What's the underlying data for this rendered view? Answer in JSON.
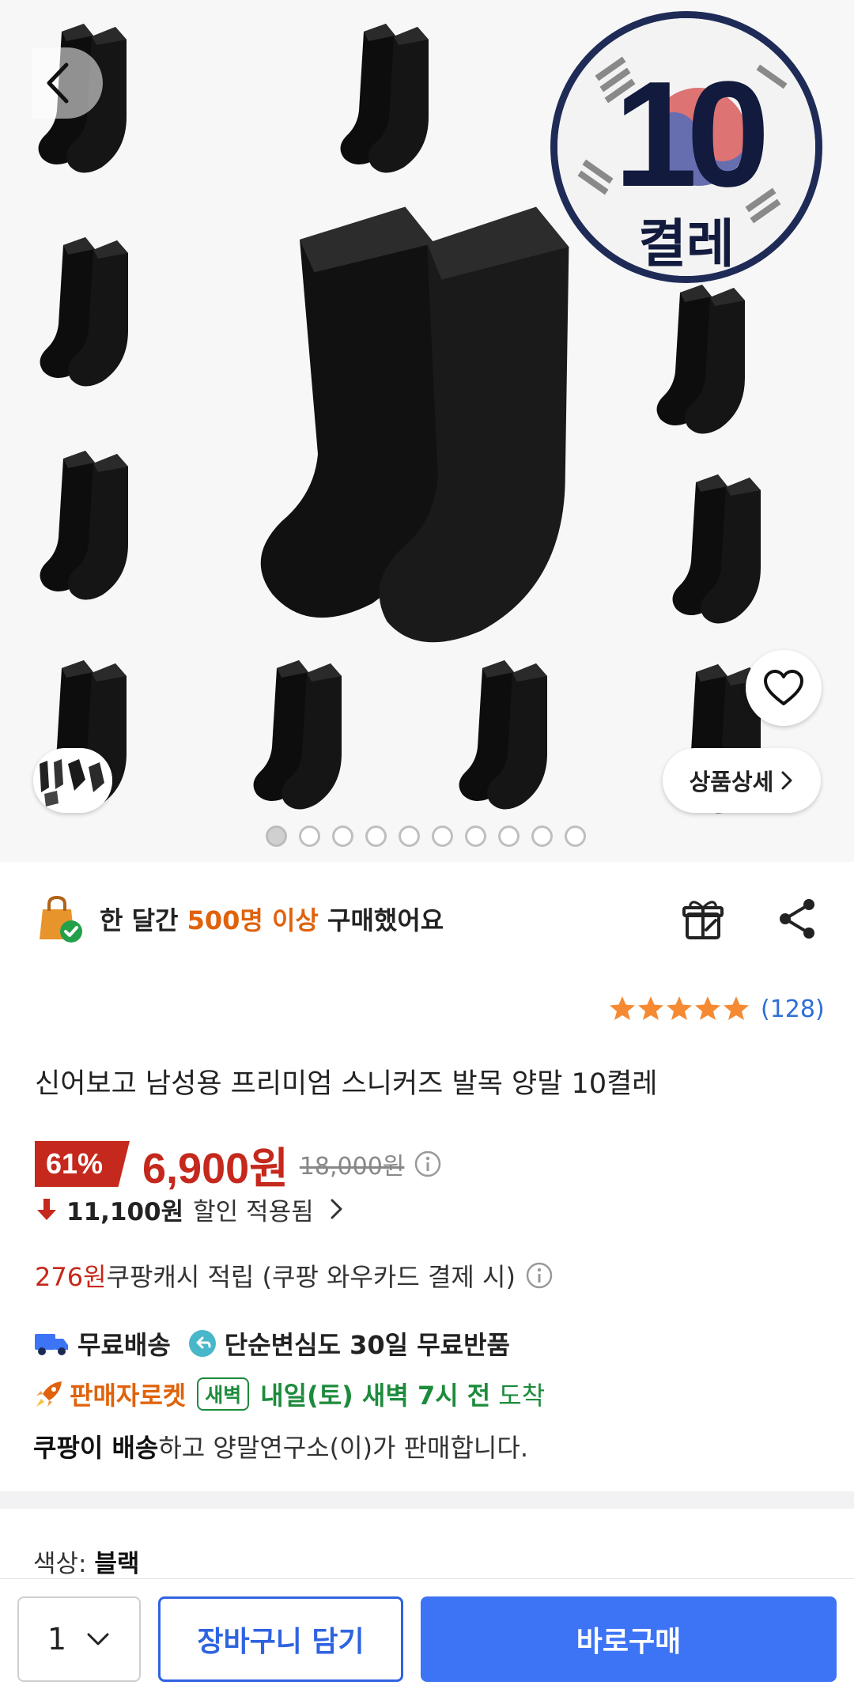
{
  "gallery": {
    "badge_number": "10",
    "badge_unit": "켤레",
    "detail_label": "상품상세",
    "slides_total": 10,
    "active_slide": 1
  },
  "social": {
    "prefix": "한 달간 ",
    "highlight": "500명 이상",
    "suffix": " 구매했어요"
  },
  "rating": {
    "stars": 5,
    "count": "(128)"
  },
  "product": {
    "title": "신어보고 남성용 프리미엄 스니커즈 발목 양말 10켤레"
  },
  "price": {
    "discount": "61%",
    "sale": "6,900원",
    "original": "18,000원",
    "discount_amount": "11,100원",
    "discount_label": "할인 적용됨"
  },
  "cash": {
    "amount": "276원",
    "label": " 쿠팡캐시 적립 (쿠팡 와우카드 결제 시)"
  },
  "shipping": {
    "free": "무료배송",
    "returns": "단순변심도 30일 무료반품"
  },
  "rocket": {
    "label": "판매자로켓",
    "badge": "새벽",
    "when": "내일(토) 새벽 7시 전",
    "arrive": "도착"
  },
  "seller": {
    "bold": "쿠팡이 배송",
    "rest": "하고 양말연구소(이)가 판매합니다."
  },
  "option": {
    "label": "색상: ",
    "value": "블랙"
  },
  "bottom": {
    "qty": "1",
    "cart": "장바구니 담기",
    "buy": "바로구매"
  },
  "colors": {
    "accent_red": "#c5281c",
    "orange": "#e0620b",
    "green": "#1d8b3c",
    "blue": "#3d73f5",
    "star": "#f58a33"
  }
}
